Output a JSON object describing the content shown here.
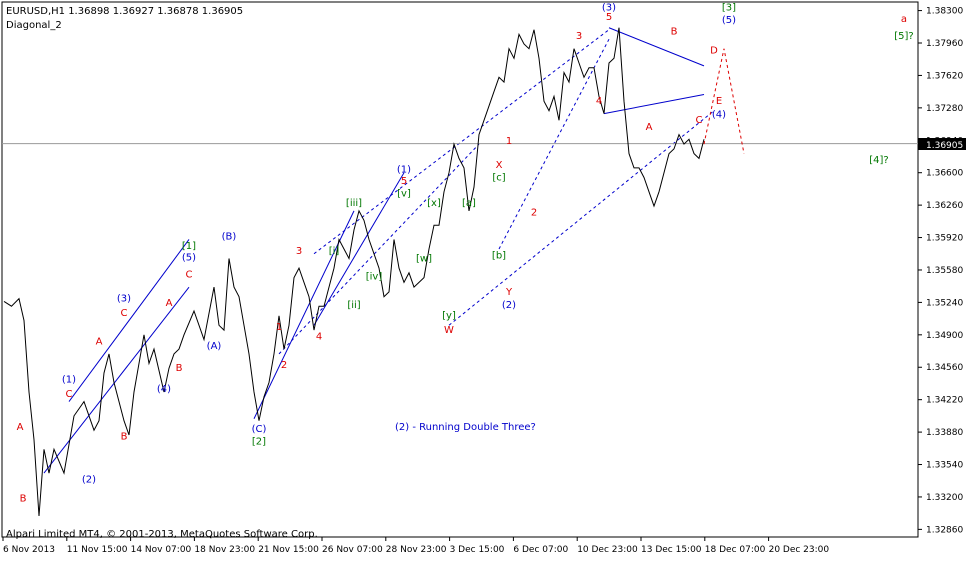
{
  "header": {
    "symbol_line": "EURUSD,H1  1.36898 1.36927 1.36878 1.36905",
    "indicator": "Diagonal_2"
  },
  "footer": {
    "copyright": "Alpari Limited MT4, © 2001-2013, MetaQuotes Software Corp."
  },
  "note": "(2) - Running Double Three?",
  "current_price_label": "1.36905",
  "colors": {
    "price": "#000000",
    "channel": "#0000cc",
    "wave_red": "#dd0000",
    "wave_blue": "#0000cc",
    "wave_green": "#007700",
    "current_line": "#999999"
  },
  "chart_data": {
    "type": "line",
    "xlabel": "",
    "ylabel": "",
    "x_tick_labels": [
      "6 Nov 2013",
      "11 Nov 15:00",
      "14 Nov 07:00",
      "18 Nov 23:00",
      "21 Nov 15:00",
      "26 Nov 07:00",
      "28 Nov 23:00",
      "3 Dec 15:00",
      "6 Dec 07:00",
      "10 Dec 23:00",
      "13 Dec 15:00",
      "18 Dec 07:00",
      "20 Dec 23:00"
    ],
    "y_tick_labels": [
      "1.38300",
      "1.37960",
      "1.37620",
      "1.37280",
      "1.36940",
      "1.36600",
      "1.36260",
      "1.35920",
      "1.35580",
      "1.35240",
      "1.34900",
      "1.34560",
      "1.34220",
      "1.33880",
      "1.33540",
      "1.33200",
      "1.32860"
    ],
    "ylim": [
      1.3278,
      1.3839
    ],
    "current_price": 1.36905,
    "series": [
      {
        "values": [
          [
            0,
            1.3525
          ],
          [
            1.5,
            1.352
          ],
          [
            3,
            1.3528
          ],
          [
            4,
            1.3505
          ],
          [
            5,
            1.343
          ],
          [
            6,
            1.338
          ],
          [
            7,
            1.33
          ],
          [
            8,
            1.337
          ],
          [
            9,
            1.3345
          ],
          [
            10,
            1.337
          ],
          [
            12,
            1.3345
          ],
          [
            14,
            1.3405
          ],
          [
            16,
            1.342
          ],
          [
            18,
            1.339
          ],
          [
            19,
            1.34
          ],
          [
            20,
            1.345
          ],
          [
            21,
            1.347
          ],
          [
            22,
            1.344
          ],
          [
            24,
            1.34
          ],
          [
            25,
            1.3385
          ],
          [
            26,
            1.343
          ],
          [
            28,
            1.349
          ],
          [
            29,
            1.346
          ],
          [
            30,
            1.3475
          ],
          [
            32,
            1.343
          ],
          [
            33,
            1.3455
          ],
          [
            34,
            1.347
          ],
          [
            35,
            1.3475
          ],
          [
            36,
            1.349
          ],
          [
            38,
            1.3515
          ],
          [
            40,
            1.3485
          ],
          [
            42,
            1.354
          ],
          [
            43,
            1.35
          ],
          [
            44,
            1.3495
          ],
          [
            45,
            1.357
          ],
          [
            46,
            1.354
          ],
          [
            47,
            1.353
          ],
          [
            48,
            1.35
          ],
          [
            49,
            1.347
          ],
          [
            50,
            1.343
          ],
          [
            51,
            1.34
          ],
          [
            52,
            1.3425
          ],
          [
            53,
            1.344
          ],
          [
            54,
            1.347
          ],
          [
            55,
            1.351
          ],
          [
            56,
            1.3475
          ],
          [
            57,
            1.35
          ],
          [
            58,
            1.355
          ],
          [
            59,
            1.356
          ],
          [
            60,
            1.3545
          ],
          [
            61,
            1.353
          ],
          [
            62,
            1.3495
          ],
          [
            63,
            1.352
          ],
          [
            64,
            1.352
          ],
          [
            65,
            1.354
          ],
          [
            66,
            1.356
          ],
          [
            67,
            1.359
          ],
          [
            68,
            1.358
          ],
          [
            69,
            1.357
          ],
          [
            70,
            1.36
          ],
          [
            71,
            1.362
          ],
          [
            72,
            1.361
          ],
          [
            73,
            1.359
          ],
          [
            74,
            1.3575
          ],
          [
            75,
            1.356
          ],
          [
            76,
            1.353
          ],
          [
            77,
            1.3535
          ],
          [
            78,
            1.359
          ],
          [
            79,
            1.356
          ],
          [
            80,
            1.3545
          ],
          [
            81,
            1.3555
          ],
          [
            82,
            1.354
          ],
          [
            83,
            1.3545
          ],
          [
            84,
            1.355
          ],
          [
            85,
            1.358
          ],
          [
            86,
            1.3605
          ],
          [
            87,
            1.3605
          ],
          [
            88,
            1.364
          ],
          [
            89,
            1.366
          ],
          [
            90,
            1.369
          ],
          [
            91,
            1.3675
          ],
          [
            92,
            1.3665
          ],
          [
            93,
            1.362
          ],
          [
            94,
            1.3645
          ],
          [
            95,
            1.37
          ],
          [
            96,
            1.3715
          ],
          [
            97,
            1.373
          ],
          [
            98,
            1.3745
          ],
          [
            99,
            1.376
          ],
          [
            100,
            1.3755
          ],
          [
            101,
            1.379
          ],
          [
            102,
            1.378
          ],
          [
            103,
            1.3805
          ],
          [
            104,
            1.3795
          ],
          [
            105,
            1.379
          ],
          [
            106,
            1.381
          ],
          [
            107,
            1.378
          ],
          [
            108,
            1.3735
          ],
          [
            109,
            1.3725
          ],
          [
            110,
            1.374
          ],
          [
            111,
            1.3715
          ],
          [
            112,
            1.3765
          ],
          [
            113,
            1.3755
          ],
          [
            114,
            1.379
          ],
          [
            115,
            1.3775
          ],
          [
            116,
            1.376
          ],
          [
            117,
            1.377
          ],
          [
            118,
            1.377
          ],
          [
            119,
            1.374
          ],
          [
            120,
            1.3722
          ],
          [
            121,
            1.3775
          ],
          [
            122,
            1.378
          ],
          [
            123,
            1.3812
          ],
          [
            124,
            1.3735
          ],
          [
            125,
            1.368
          ],
          [
            126,
            1.3665
          ],
          [
            127,
            1.3665
          ],
          [
            128,
            1.3655
          ],
          [
            129,
            1.364
          ],
          [
            130,
            1.3625
          ],
          [
            131,
            1.364
          ],
          [
            132,
            1.366
          ],
          [
            133,
            1.368
          ],
          [
            134,
            1.3685
          ],
          [
            135,
            1.37
          ],
          [
            136,
            1.369
          ],
          [
            137,
            1.3695
          ],
          [
            138,
            1.368
          ],
          [
            139,
            1.3675
          ],
          [
            140,
            1.3695
          ]
        ]
      }
    ],
    "forecast": [
      [
        140,
        1.369
      ],
      [
        144,
        1.379
      ],
      [
        148,
        1.368
      ]
    ]
  },
  "annotations": [
    {
      "text": "A",
      "color": "wave_red",
      "x": 3.2,
      "p": 1.339
    },
    {
      "text": "B",
      "color": "wave_red",
      "x": 3.8,
      "p": 1.3315
    },
    {
      "text": "(1)",
      "color": "wave_blue",
      "x": 13,
      "p": 1.344
    },
    {
      "text": "C",
      "color": "wave_red",
      "x": 13,
      "p": 1.3425
    },
    {
      "text": "(2)",
      "color": "wave_blue",
      "x": 17,
      "p": 1.3335
    },
    {
      "text": "A",
      "color": "wave_red",
      "x": 19,
      "p": 1.348
    },
    {
      "text": "B",
      "color": "wave_red",
      "x": 24,
      "p": 1.338
    },
    {
      "text": "(3)",
      "color": "wave_blue",
      "x": 24,
      "p": 1.3525
    },
    {
      "text": "C",
      "color": "wave_red",
      "x": 24,
      "p": 1.351
    },
    {
      "text": "A",
      "color": "wave_red",
      "x": 33,
      "p": 1.352
    },
    {
      "text": "B",
      "color": "wave_red",
      "x": 35,
      "p": 1.3452
    },
    {
      "text": "(4)",
      "color": "wave_blue",
      "x": 32,
      "p": 1.343
    },
    {
      "text": "[1]",
      "color": "wave_green",
      "x": 37,
      "p": 1.358
    },
    {
      "text": "(5)",
      "color": "wave_blue",
      "x": 37,
      "p": 1.3568
    },
    {
      "text": "C",
      "color": "wave_red",
      "x": 37,
      "p": 1.355
    },
    {
      "text": "(A)",
      "color": "wave_blue",
      "x": 42,
      "p": 1.3475
    },
    {
      "text": "(B)",
      "color": "wave_blue",
      "x": 45,
      "p": 1.359
    },
    {
      "text": "(C)",
      "color": "wave_blue",
      "x": 51,
      "p": 1.3388
    },
    {
      "text": "[2]",
      "color": "wave_green",
      "x": 51,
      "p": 1.3375
    },
    {
      "text": "1",
      "color": "wave_red",
      "x": 55,
      "p": 1.3495
    },
    {
      "text": "2",
      "color": "wave_red",
      "x": 56,
      "p": 1.3455
    },
    {
      "text": "3",
      "color": "wave_red",
      "x": 59,
      "p": 1.3575
    },
    {
      "text": "4",
      "color": "wave_red",
      "x": 63,
      "p": 1.3485
    },
    {
      "text": "[i]",
      "color": "wave_green",
      "x": 66,
      "p": 1.3575
    },
    {
      "text": "[ii]",
      "color": "wave_green",
      "x": 70,
      "p": 1.3518
    },
    {
      "text": "[iii]",
      "color": "wave_green",
      "x": 70,
      "p": 1.3625
    },
    {
      "text": "[iv]",
      "color": "wave_green",
      "x": 74,
      "p": 1.3548
    },
    {
      "text": "(1)",
      "color": "wave_blue",
      "x": 80,
      "p": 1.366
    },
    {
      "text": "5",
      "color": "wave_red",
      "x": 80,
      "p": 1.3648
    },
    {
      "text": "[v]",
      "color": "wave_green",
      "x": 80,
      "p": 1.3635
    },
    {
      "text": "[x]",
      "color": "wave_green",
      "x": 86,
      "p": 1.3625
    },
    {
      "text": "[w]",
      "color": "wave_green",
      "x": 84,
      "p": 1.3567
    },
    {
      "text": "[a]",
      "color": "wave_green",
      "x": 93,
      "p": 1.3625
    },
    {
      "text": "[y]",
      "color": "wave_green",
      "x": 89,
      "p": 1.3507
    },
    {
      "text": "W",
      "color": "wave_red",
      "x": 89,
      "p": 1.3492
    },
    {
      "text": "[b]",
      "color": "wave_green",
      "x": 99,
      "p": 1.357
    },
    {
      "text": "Y",
      "color": "wave_red",
      "x": 101,
      "p": 1.3532
    },
    {
      "text": "(2)",
      "color": "wave_blue",
      "x": 101,
      "p": 1.3518
    },
    {
      "text": "X",
      "color": "wave_red",
      "x": 99,
      "p": 1.3665
    },
    {
      "text": "[c]",
      "color": "wave_green",
      "x": 99,
      "p": 1.3652
    },
    {
      "text": "1",
      "color": "wave_red",
      "x": 101,
      "p": 1.369
    },
    {
      "text": "2",
      "color": "wave_red",
      "x": 106,
      "p": 1.3615
    },
    {
      "text": "3",
      "color": "wave_red",
      "x": 115,
      "p": 1.38
    },
    {
      "text": "4",
      "color": "wave_red",
      "x": 119,
      "p": 1.3732
    },
    {
      "text": "(3)",
      "color": "wave_blue",
      "x": 121,
      "p": 1.383
    },
    {
      "text": "5",
      "color": "wave_red",
      "x": 121,
      "p": 1.382
    },
    {
      "text": "B",
      "color": "wave_red",
      "x": 134,
      "p": 1.3805
    },
    {
      "text": "A",
      "color": "wave_red",
      "x": 129,
      "p": 1.3705
    },
    {
      "text": "C",
      "color": "wave_red",
      "x": 139,
      "p": 1.3712
    },
    {
      "text": "D",
      "color": "wave_red",
      "x": 142,
      "p": 1.3785
    },
    {
      "text": "E",
      "color": "wave_red",
      "x": 143,
      "p": 1.3732
    },
    {
      "text": "(4)",
      "color": "wave_blue",
      "x": 143,
      "p": 1.3718
    },
    {
      "text": "[3]",
      "color": "wave_green",
      "x": 145,
      "p": 1.383
    },
    {
      "text": "(5)",
      "color": "wave_blue",
      "x": 145,
      "p": 1.3817
    },
    {
      "text": "a",
      "color": "wave_red",
      "x": 180,
      "p": 1.3818
    },
    {
      "text": "[5]?",
      "color": "wave_green",
      "x": 180,
      "p": 1.38
    },
    {
      "text": "[4]?",
      "color": "wave_green",
      "x": 175,
      "p": 1.367
    }
  ]
}
